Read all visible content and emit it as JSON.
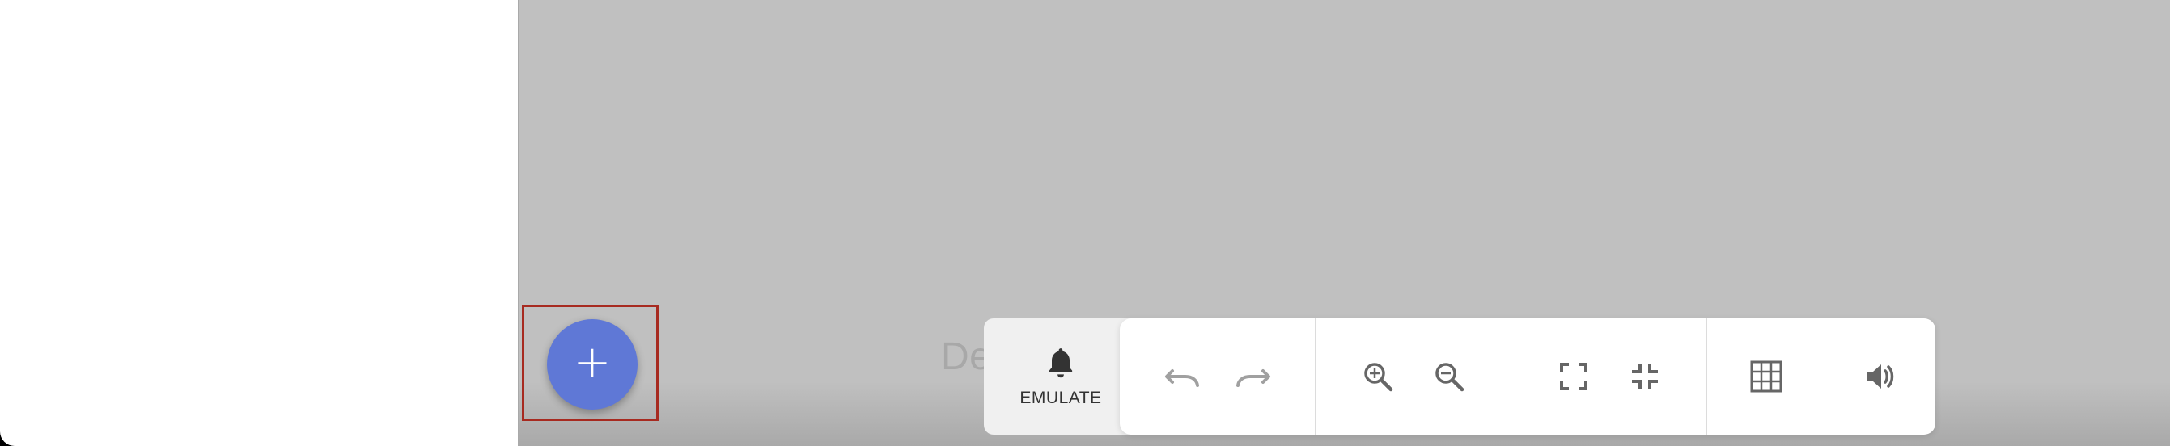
{
  "canvas": {
    "hint_text": "De"
  },
  "fab": {
    "label": "+"
  },
  "emulate": {
    "label": "EMULATE",
    "icon": "bell-icon"
  },
  "toolbar": {
    "groups": [
      {
        "buttons": [
          {
            "icon": "undo-icon",
            "enabled": false
          },
          {
            "icon": "redo-icon",
            "enabled": false
          }
        ]
      },
      {
        "buttons": [
          {
            "icon": "zoom-in-icon",
            "enabled": true
          },
          {
            "icon": "zoom-out-icon",
            "enabled": true
          }
        ]
      },
      {
        "buttons": [
          {
            "icon": "fullscreen-icon",
            "enabled": true
          },
          {
            "icon": "exit-fullscreen-icon",
            "enabled": true
          }
        ]
      },
      {
        "buttons": [
          {
            "icon": "grid-icon",
            "enabled": true
          }
        ]
      },
      {
        "buttons": [
          {
            "icon": "volume-icon",
            "enabled": true
          }
        ]
      }
    ]
  },
  "colors": {
    "fab": "#5f78d6",
    "highlight": "#a72a20",
    "canvas": "#c0c0c0",
    "icon_active": "#666666",
    "icon_disabled": "#a0a0a0"
  }
}
